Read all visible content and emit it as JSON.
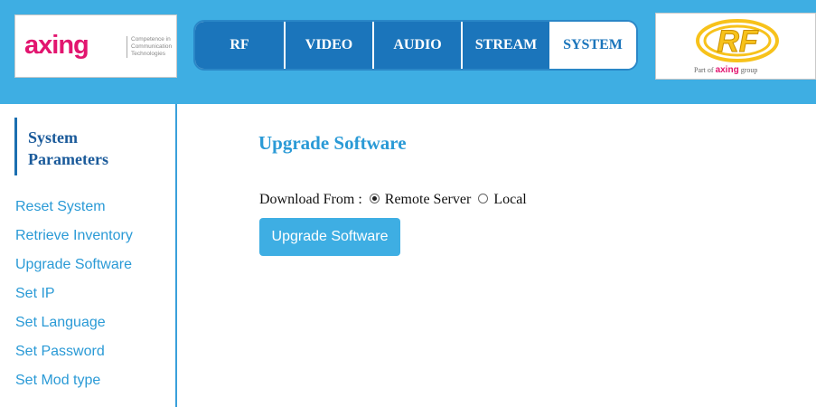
{
  "header": {
    "brand_logo": {
      "wordmark": "axing",
      "tagline": [
        "Competence in",
        "Communication",
        "Technologies"
      ]
    },
    "partner_logo": {
      "mark": "RF",
      "part_of_prefix": "Part of",
      "part_of_brand": "axing",
      "part_of_suffix": "group"
    },
    "tabs": [
      {
        "label": "RF",
        "active": false
      },
      {
        "label": "VIDEO",
        "active": false
      },
      {
        "label": "AUDIO",
        "active": false
      },
      {
        "label": "STREAM",
        "active": false
      },
      {
        "label": "SYSTEM",
        "active": true
      }
    ]
  },
  "sidebar": {
    "title": "System Parameters",
    "items": [
      {
        "label": "Reset System"
      },
      {
        "label": "Retrieve Inventory"
      },
      {
        "label": "Upgrade Software"
      },
      {
        "label": "Set IP"
      },
      {
        "label": "Set Language"
      },
      {
        "label": "Set Password"
      },
      {
        "label": "Set Mod type"
      }
    ]
  },
  "main": {
    "title": "Upgrade Software",
    "download_from_label": "Download From :",
    "options": [
      {
        "label": "Remote Server",
        "selected": true
      },
      {
        "label": "Local",
        "selected": false
      }
    ],
    "button_label": "Upgrade Software"
  },
  "colors": {
    "header_bg": "#3eaee3",
    "tab_bg": "#1b75bb",
    "brand_pink": "#e2156f",
    "link_blue": "#2a9ad6",
    "rf_yellow": "#f7c21b"
  }
}
